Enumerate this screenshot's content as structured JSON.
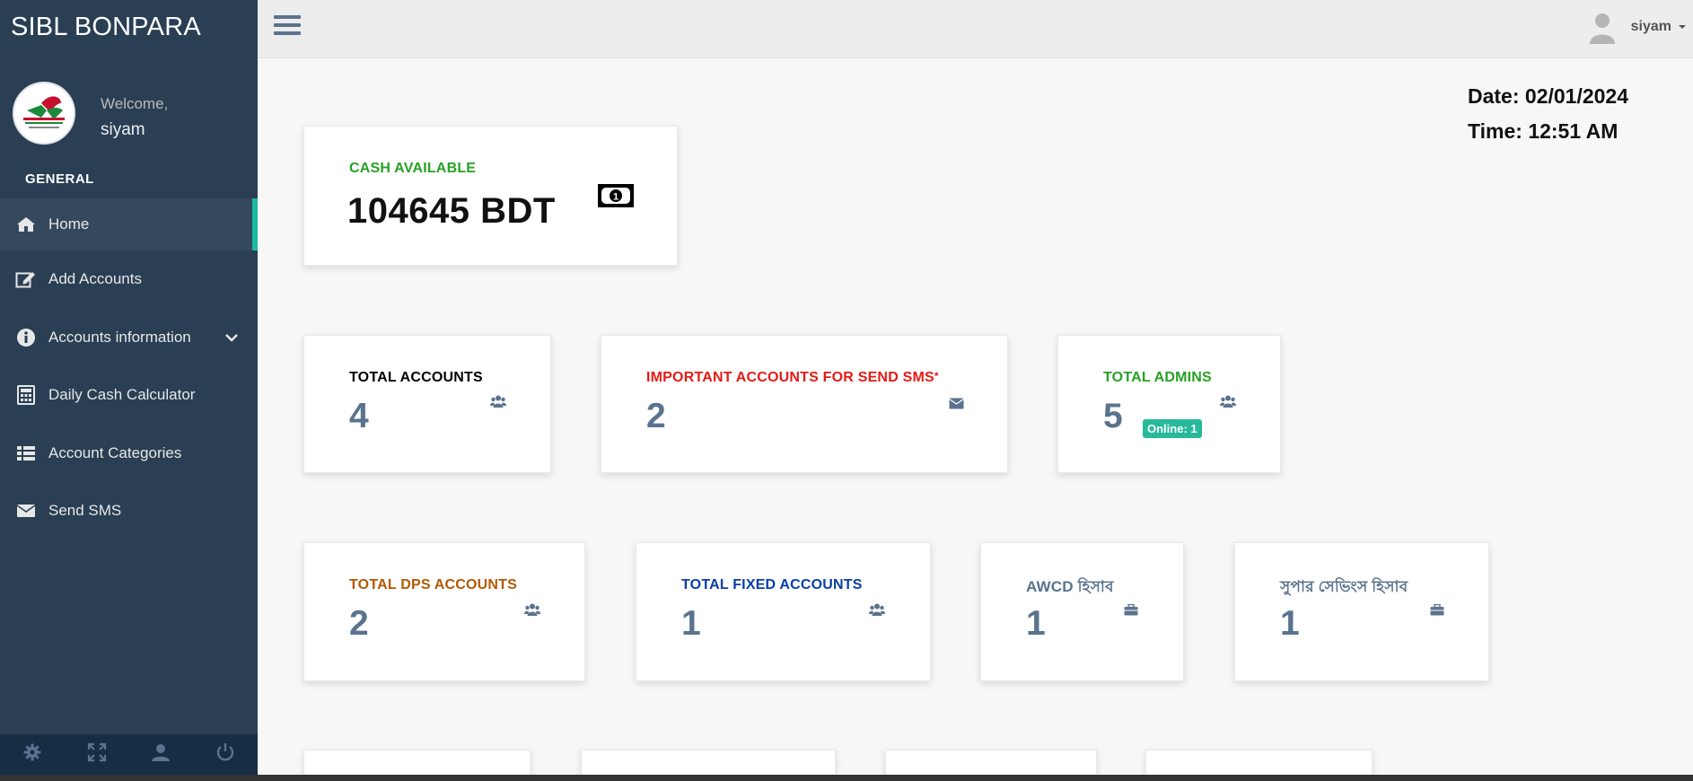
{
  "sidebar": {
    "brand": "SIBL BONPARA",
    "welcome": "Welcome,",
    "username": "siyam",
    "section": "GENERAL",
    "items": [
      {
        "label": "Home",
        "icon": "home-icon"
      },
      {
        "label": "Add Accounts",
        "icon": "edit-icon"
      },
      {
        "label": "Accounts information",
        "icon": "info-icon"
      },
      {
        "label": "Daily Cash Calculator",
        "icon": "calculator-icon"
      },
      {
        "label": "Account Categories",
        "icon": "table-icon"
      },
      {
        "label": "Send SMS",
        "icon": "envelope-icon"
      }
    ],
    "footer": [
      "gear-icon",
      "fullscreen-icon",
      "user-icon",
      "power-icon"
    ]
  },
  "topnav": {
    "user": "siyam"
  },
  "datetime": {
    "date": "Date: 02/01/2024",
    "time": "Time: 12:51 AM"
  },
  "cards": {
    "cash": {
      "title": "CASH AVAILABLE",
      "value": "104645 BDT",
      "color": "#26a124"
    },
    "total_accounts": {
      "title": "TOTAL ACCOUNTS",
      "value": "4",
      "color": "#000000"
    },
    "important_accounts": {
      "title": "IMPORTANT ACCOUNTS FOR SEND SMS",
      "star": "*",
      "value": "2",
      "color": "#e41b17"
    },
    "total_admins": {
      "title": "TOTAL ADMINS",
      "value": "5",
      "badge": "Online: 1",
      "color": "#26a124"
    },
    "dps": {
      "title": "TOTAL DPS ACCOUNTS",
      "value": "2",
      "color": "#b35900"
    },
    "fixed": {
      "title": "TOTAL FIXED ACCOUNTS",
      "value": "1",
      "color": "#0a3ea8"
    },
    "awcd": {
      "title": "AWCD হিসাব",
      "value": "1",
      "color": "#5a738e"
    },
    "super": {
      "title": "সুপার সেভিংস হিসাব",
      "value": "1",
      "color": "#5a738e"
    }
  },
  "colors": {
    "sidebar_bg": "#2a3f54",
    "accent": "#1abb9c",
    "value_text": "#5a738e",
    "badge_bg": "#26b99a"
  }
}
